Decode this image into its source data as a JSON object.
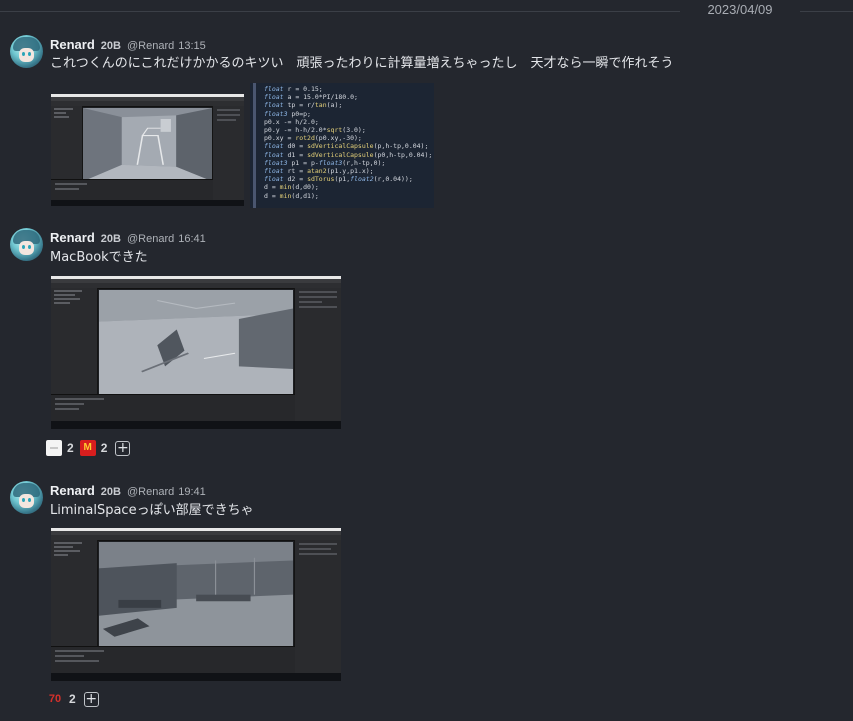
{
  "date_divider": "2023/04/09",
  "messages": [
    {
      "author": "Renard",
      "badge": "20B",
      "handle": "@Renard",
      "time": "13:15",
      "text": "これつくんのにこれだけかかるのキツい　頑張ったわりに計算量増えちゃったし　天才なら一瞬で作れそう",
      "attachments": [
        "unity-editor-screenshot",
        "shader-code-screenshot"
      ],
      "code_lines": [
        "float r = 0.15;",
        "float a = 15.0*PI/180.0;",
        "float tp = r/tan(a);",
        "float3 p0=p;",
        "p0.x -= h/2.0;",
        "p0.y -= h-h/2.0*sqrt(3.0);",
        "p0.xy = rot2d(p0.xy,-30);",
        "float d0 = sdVerticalCapsule(p,h-tp,0.04);",
        "float d1 = sdVerticalCapsule(p0,h-tp,0.04);",
        "float3 p1 = p-float3(r,h-tp,0);",
        "float rt = atan2(p1.y,p1.x);",
        "float d2 = sdTorus(p1,float2(r,0.04));",
        "d = min(d,d0);",
        "d = min(d,d1);"
      ],
      "reactions": []
    },
    {
      "author": "Renard",
      "badge": "20B",
      "handle": "@Renard",
      "time": "16:41",
      "text": "MacBookできた",
      "attachments": [
        "unity-editor-screenshot"
      ],
      "reactions": [
        {
          "emoji": "white-blank-emoji",
          "count": "2"
        },
        {
          "emoji": "mcdonalds-emoji",
          "count": "2"
        }
      ],
      "add_reaction_label": "+"
    },
    {
      "author": "Renard",
      "badge": "20B",
      "handle": "@Renard",
      "time": "19:41",
      "text": "LiminalSpaceっぽい部屋できちゃ",
      "attachments": [
        "unity-editor-screenshot"
      ],
      "reactions": [
        {
          "emoji": "seventy-emoji",
          "glyph": "70",
          "count": "2"
        }
      ],
      "add_reaction_label": "+"
    }
  ],
  "colors": {
    "background": "#24272e",
    "name": "#eef0f3",
    "meta": "#aeb2b8",
    "code_bg": "#1c2533",
    "keyword": "#8fb8e8",
    "function": "#e6d27a"
  }
}
